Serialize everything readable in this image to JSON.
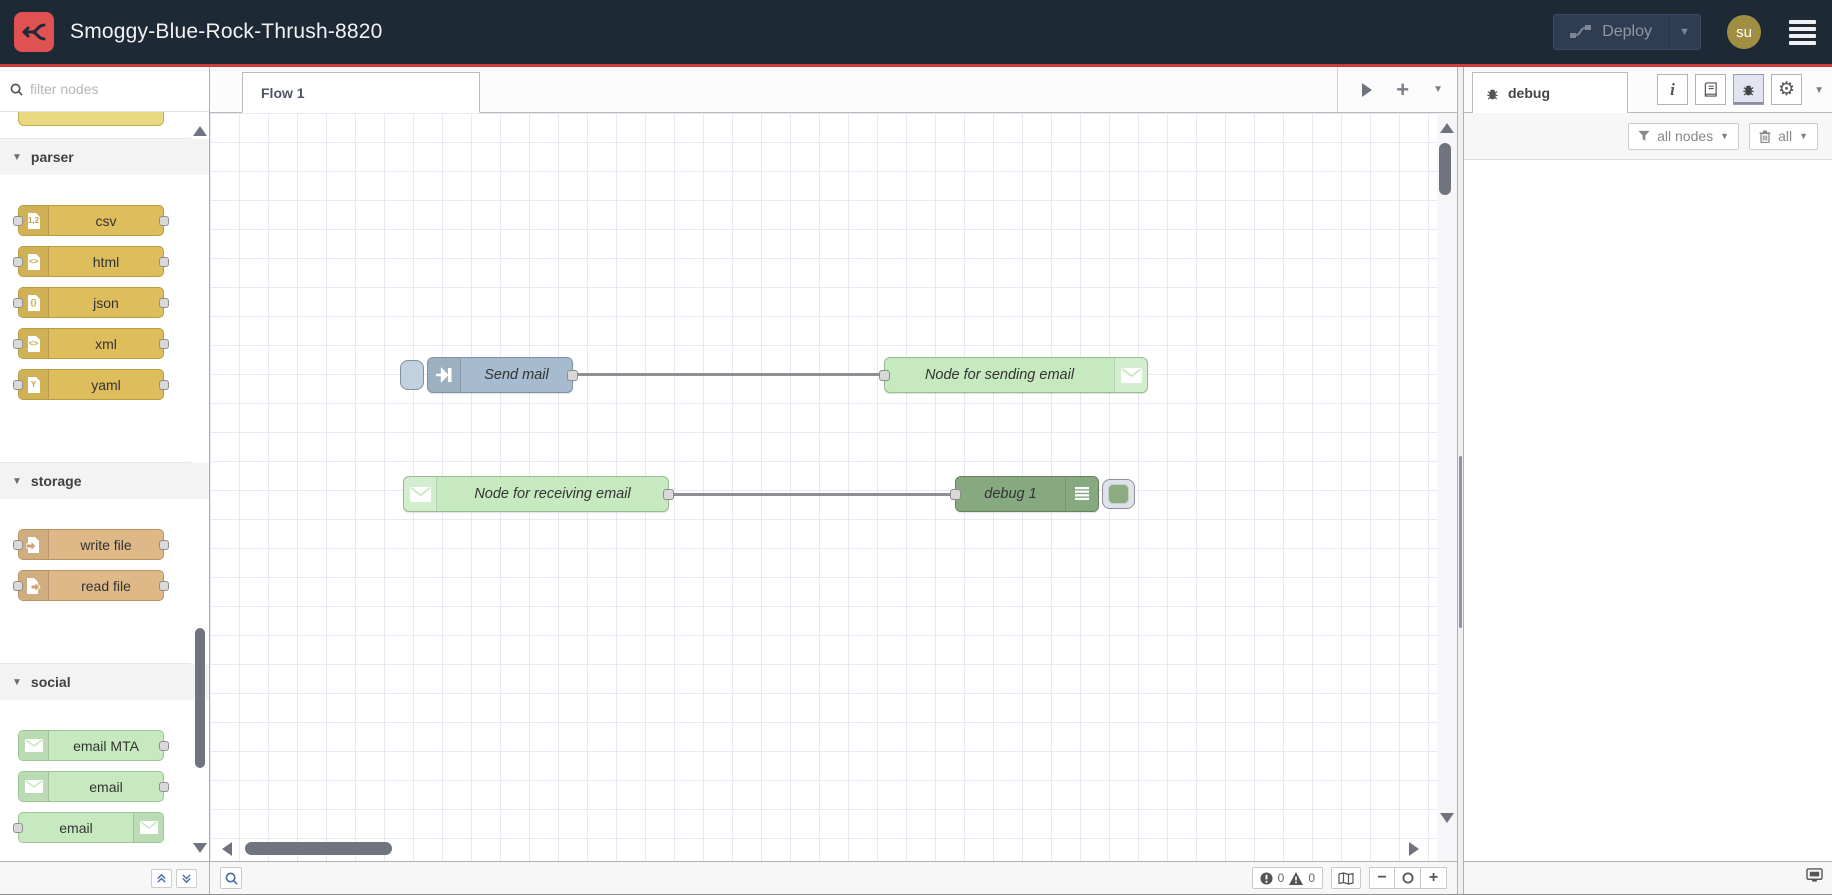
{
  "header": {
    "title": "Smoggy-Blue-Rock-Thrush-8820",
    "deploy_label": "Deploy",
    "user_initials": "su",
    "colors": {
      "header_bg": "#1e2936",
      "accent_red": "#cf3b3b",
      "logo_red": "#e05151",
      "avatar": "#a08f42"
    }
  },
  "palette": {
    "filter_placeholder": "filter nodes",
    "categories": [
      {
        "label": "parser",
        "color": "#debd5c",
        "nodes": [
          {
            "label": "csv",
            "glyph": "1,2"
          },
          {
            "label": "html",
            "glyph": "<>"
          },
          {
            "label": "json",
            "glyph": "{}"
          },
          {
            "label": "xml",
            "glyph": "<>"
          },
          {
            "label": "yaml",
            "glyph": "Y"
          }
        ]
      },
      {
        "label": "storage",
        "color": "#deb887",
        "nodes": [
          {
            "label": "write file"
          },
          {
            "label": "read file"
          }
        ]
      },
      {
        "label": "social",
        "color": "#c7e9c0",
        "nodes": [
          {
            "label": "email MTA"
          },
          {
            "label": "email"
          },
          {
            "label": "email"
          }
        ]
      }
    ]
  },
  "workspace": {
    "tab_label": "Flow 1",
    "flow_nodes": {
      "inject": {
        "label": "Send mail",
        "color": "#a6bbcf"
      },
      "email_out": {
        "label": "Node for sending email",
        "color": "#c7e9c0"
      },
      "email_in": {
        "label": "Node for receiving email",
        "color": "#c7e9c0"
      },
      "debug": {
        "label": "debug 1",
        "color": "#87a980"
      }
    },
    "footer": {
      "error_count": "0",
      "warning_count": "0"
    }
  },
  "sidebar": {
    "tab_label": "debug",
    "toolbar": {
      "filter_label": "all nodes",
      "clear_label": "all"
    }
  }
}
